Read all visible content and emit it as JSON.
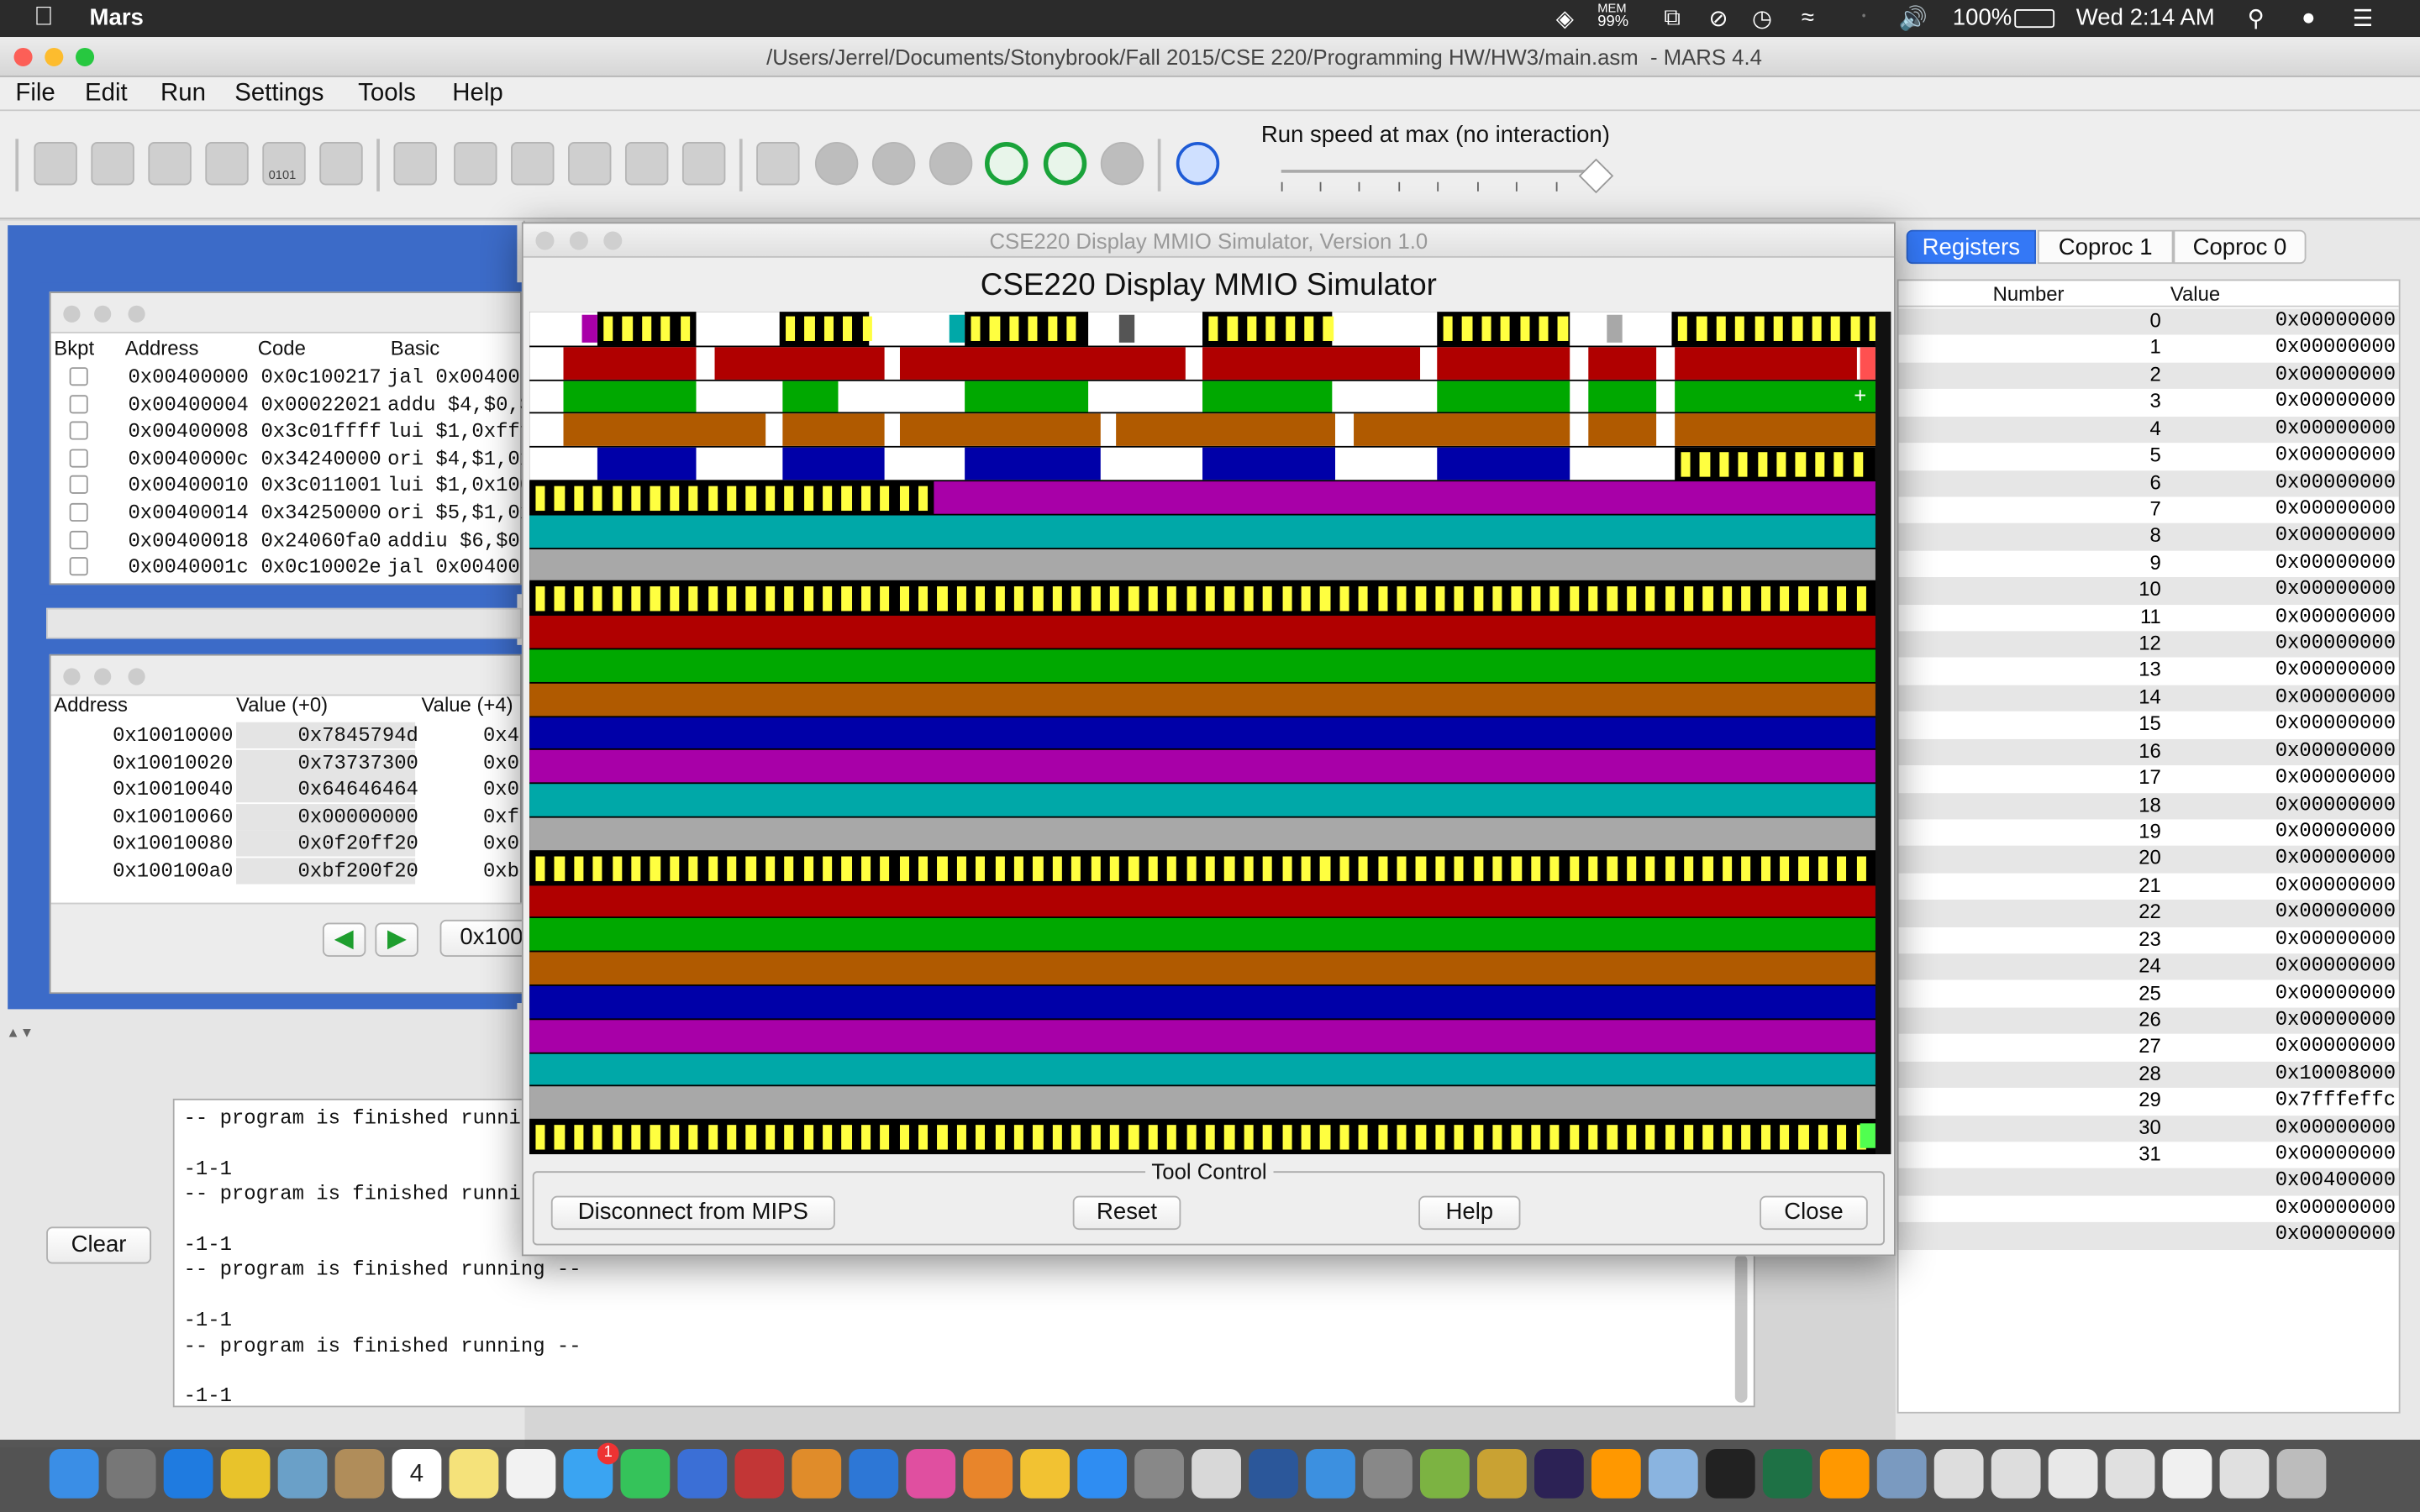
{
  "mac_menubar": {
    "app": "Mars",
    "mem_label": "MEM",
    "mem_value": "99%",
    "battery": "100%",
    "clock": "Wed 2:14 AM"
  },
  "window": {
    "title": "/Users/Jerrel/Documents/Stonybrook/Fall 2015/CSE 220/Programming HW/HW3/main.asm  - MARS 4.4"
  },
  "menu": [
    "File",
    "Edit",
    "Run",
    "Settings",
    "Tools",
    "Help"
  ],
  "toolbar": {
    "run_speed": "Run speed at max (no interaction)",
    "step_label": "0101"
  },
  "text_segment": {
    "headers": [
      "Bkpt",
      "Address",
      "Code",
      "Basic"
    ],
    "rows": [
      {
        "address": "0x00400000",
        "code": "0x0c100217",
        "basic": "jal 0x00400"
      },
      {
        "address": "0x00400004",
        "code": "0x00022021",
        "basic": "addu $4,$0,$"
      },
      {
        "address": "0x00400008",
        "code": "0x3c01ffff",
        "basic": "lui $1,0xfff"
      },
      {
        "address": "0x0040000c",
        "code": "0x34240000",
        "basic": "ori $4,$1,0x"
      },
      {
        "address": "0x00400010",
        "code": "0x3c011001",
        "basic": "lui $1,0x100"
      },
      {
        "address": "0x00400014",
        "code": "0x34250000",
        "basic": "ori $5,$1,0x"
      },
      {
        "address": "0x00400018",
        "code": "0x24060fa0",
        "basic": "addiu $6,$0,"
      },
      {
        "address": "0x0040001c",
        "code": "0x0c10002e",
        "basic": "jal 0x00400"
      }
    ]
  },
  "data_segment": {
    "headers": [
      "Address",
      "Value (+0)",
      "Value (+4)"
    ],
    "rows": [
      {
        "address": "0x10010000",
        "v0": "0x7845794d",
        "v4": "0x4"
      },
      {
        "address": "0x10010020",
        "v0": "0x73737300",
        "v4": "0x0"
      },
      {
        "address": "0x10010040",
        "v0": "0x64646464",
        "v4": "0x0"
      },
      {
        "address": "0x10010060",
        "v0": "0x00000000",
        "v4": "0xf"
      },
      {
        "address": "0x10010080",
        "v0": "0x0f20ff20",
        "v4": "0x0"
      },
      {
        "address": "0x100100a0",
        "v0": "0xbf200f20",
        "v4": "0xb"
      }
    ],
    "nav_address": "0x100"
  },
  "console": {
    "clear_label": "Clear",
    "lines": [
      "-- program is finished running",
      "",
      "-1-1",
      "-- program is finished running",
      "",
      "-1-1",
      "-- program is finished running --",
      "",
      "-1-1",
      "-- program is finished running --",
      "",
      "-1-1"
    ]
  },
  "registers": {
    "tabs": [
      "Registers",
      "Coproc 1",
      "Coproc 0"
    ],
    "headers": [
      "Number",
      "Value"
    ],
    "rows": [
      {
        "n": "0",
        "v": "0x00000000"
      },
      {
        "n": "1",
        "v": "0x00000000"
      },
      {
        "n": "2",
        "v": "0x00000000"
      },
      {
        "n": "3",
        "v": "0x00000000"
      },
      {
        "n": "4",
        "v": "0x00000000"
      },
      {
        "n": "5",
        "v": "0x00000000"
      },
      {
        "n": "6",
        "v": "0x00000000"
      },
      {
        "n": "7",
        "v": "0x00000000"
      },
      {
        "n": "8",
        "v": "0x00000000"
      },
      {
        "n": "9",
        "v": "0x00000000"
      },
      {
        "n": "10",
        "v": "0x00000000"
      },
      {
        "n": "11",
        "v": "0x00000000"
      },
      {
        "n": "12",
        "v": "0x00000000"
      },
      {
        "n": "13",
        "v": "0x00000000"
      },
      {
        "n": "14",
        "v": "0x00000000"
      },
      {
        "n": "15",
        "v": "0x00000000"
      },
      {
        "n": "16",
        "v": "0x00000000"
      },
      {
        "n": "17",
        "v": "0x00000000"
      },
      {
        "n": "18",
        "v": "0x00000000"
      },
      {
        "n": "19",
        "v": "0x00000000"
      },
      {
        "n": "20",
        "v": "0x00000000"
      },
      {
        "n": "21",
        "v": "0x00000000"
      },
      {
        "n": "22",
        "v": "0x00000000"
      },
      {
        "n": "23",
        "v": "0x00000000"
      },
      {
        "n": "24",
        "v": "0x00000000"
      },
      {
        "n": "25",
        "v": "0x00000000"
      },
      {
        "n": "26",
        "v": "0x00000000"
      },
      {
        "n": "27",
        "v": "0x00000000"
      },
      {
        "n": "28",
        "v": "0x10008000"
      },
      {
        "n": "29",
        "v": "0x7fffeffc"
      },
      {
        "n": "30",
        "v": "0x00000000"
      },
      {
        "n": "31",
        "v": "0x00000000"
      },
      {
        "n": "",
        "v": "0x00400000"
      },
      {
        "n": "",
        "v": "0x00000000"
      },
      {
        "n": "",
        "v": "0x00000000"
      }
    ]
  },
  "mmio": {
    "window_title": "CSE220 Display MMIO Simulator, Version 1.0",
    "heading": "CSE220 Display MMIO Simulator",
    "tool_control": "Tool Control",
    "buttons": {
      "disconnect": "Disconnect from MIPS",
      "reset": "Reset",
      "help": "Help",
      "close": "Close"
    },
    "colors": {
      "red": "#b00000",
      "green": "#00a800",
      "orange": "#b05a00",
      "blue": "#0000a8",
      "magenta": "#a800a8",
      "cyan": "#00a8a8",
      "gray": "#a8a8a8",
      "yellow": "#ffff40",
      "black": "#000000",
      "white": "#ffffff",
      "light_red": "#ff5050",
      "light_green": "#50ff50",
      "dark_gray": "#555555"
    },
    "rows": [
      "header",
      "red-seg",
      "green-seg",
      "orange-seg",
      "blue-seg",
      "yb-then-magenta",
      "cyan",
      "gray",
      "yellow-black",
      "red",
      "green",
      "orange",
      "blue",
      "magenta",
      "cyan",
      "gray",
      "yellow-black",
      "red",
      "green",
      "orange",
      "blue",
      "magenta",
      "cyan",
      "gray",
      "yellow-black-end"
    ]
  },
  "dock": {
    "calendar_day": "4",
    "badge": "1"
  }
}
